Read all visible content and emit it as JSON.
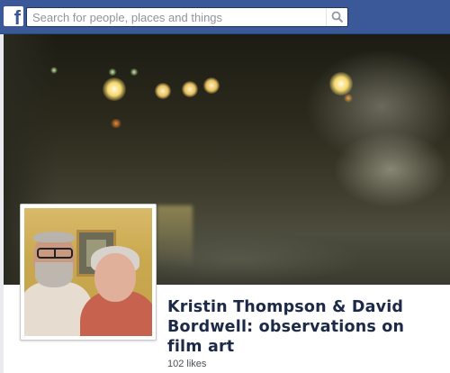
{
  "topbar": {
    "logo_letter": "f",
    "logo_icon": "facebook-logo-icon",
    "search": {
      "placeholder": "Search for people, places and things",
      "value": "",
      "icon": "magnifier-icon"
    },
    "color": "#3b5998"
  },
  "page": {
    "name": "Kristin Thompson & David Bordwell: observations on film art",
    "likes": "102 likes"
  }
}
